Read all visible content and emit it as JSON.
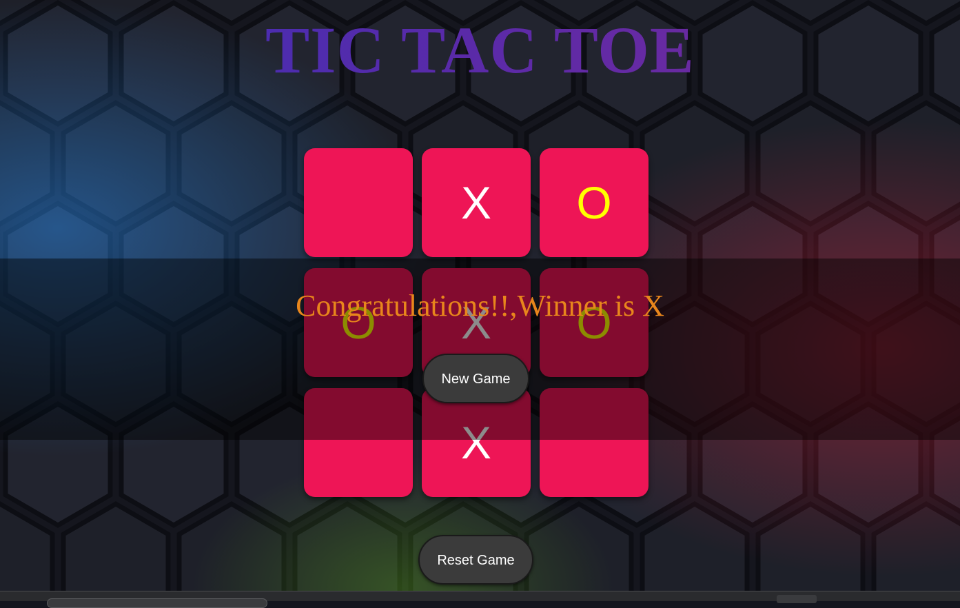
{
  "game": {
    "title": "TIC TAC TOE",
    "board": [
      "",
      "X",
      "O",
      "O",
      "X",
      "O",
      "",
      "X",
      ""
    ],
    "winner_message": "Congratulations!!,Winner is X",
    "new_game_label": "New Game",
    "reset_label": "Reset Game"
  },
  "colors": {
    "cell_background": "#ee1556",
    "x_color": "#ffffff",
    "o_color": "#ffff00",
    "message_color": "#e8861c",
    "button_background": "#3b3b3b",
    "title_gradient_start": "#3a2fb8",
    "title_gradient_end": "#7a2b9a"
  }
}
